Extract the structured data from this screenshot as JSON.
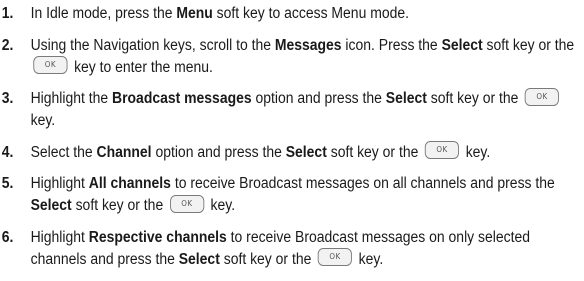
{
  "steps": [
    {
      "num": "1.",
      "parts": [
        {
          "t": "text",
          "v": "In Idle mode, press the "
        },
        {
          "t": "bold",
          "v": "Menu"
        },
        {
          "t": "text",
          "v": " soft key to access Menu mode."
        }
      ]
    },
    {
      "num": "2.",
      "parts": [
        {
          "t": "text",
          "v": "Using the Navigation keys, scroll to the "
        },
        {
          "t": "bold",
          "v": "Messages"
        },
        {
          "t": "text",
          "v": " icon. Press the "
        },
        {
          "t": "bold",
          "v": "Select"
        },
        {
          "t": "text",
          "v": " soft key or the "
        },
        {
          "t": "key",
          "v": "OK"
        },
        {
          "t": "text",
          "v": " key to enter the menu."
        }
      ]
    },
    {
      "num": "3.",
      "parts": [
        {
          "t": "text",
          "v": "Highlight the "
        },
        {
          "t": "bold",
          "v": "Broadcast messages"
        },
        {
          "t": "text",
          "v": " option and press the "
        },
        {
          "t": "bold",
          "v": "Select"
        },
        {
          "t": "text",
          "v": " soft key or the "
        },
        {
          "t": "key",
          "v": "OK"
        },
        {
          "t": "text",
          "v": " key."
        }
      ]
    },
    {
      "num": "4.",
      "parts": [
        {
          "t": "text",
          "v": "Select the "
        },
        {
          "t": "bold",
          "v": "Channel"
        },
        {
          "t": "text",
          "v": " option and press the "
        },
        {
          "t": "bold",
          "v": "Select"
        },
        {
          "t": "text",
          "v": " soft key or the "
        },
        {
          "t": "key",
          "v": "OK"
        },
        {
          "t": "text",
          "v": " key."
        }
      ]
    },
    {
      "num": "5.",
      "parts": [
        {
          "t": "text",
          "v": "Highlight "
        },
        {
          "t": "bold",
          "v": "All channels"
        },
        {
          "t": "text",
          "v": " to receive Broadcast messages on all channels and press the "
        },
        {
          "t": "bold",
          "v": "Select"
        },
        {
          "t": "text",
          "v": " soft key or the "
        },
        {
          "t": "key",
          "v": "OK"
        },
        {
          "t": "text",
          "v": " key."
        }
      ]
    },
    {
      "num": "6.",
      "parts": [
        {
          "t": "text",
          "v": "Highlight "
        },
        {
          "t": "bold",
          "v": "Respective channels"
        },
        {
          "t": "text",
          "v": " to receive Broadcast messages on only selected channels and press the "
        },
        {
          "t": "bold",
          "v": "Select"
        },
        {
          "t": "text",
          "v": " soft key or the "
        },
        {
          "t": "key",
          "v": "OK"
        },
        {
          "t": "text",
          "v": " key."
        }
      ]
    }
  ]
}
